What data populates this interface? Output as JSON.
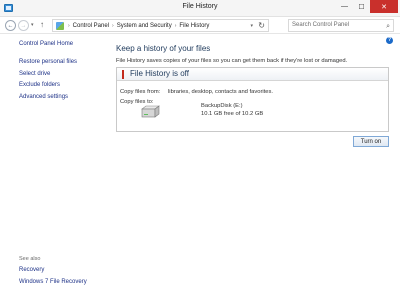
{
  "window": {
    "title": "File History",
    "minimize_glyph": "—",
    "maximize_glyph": "☐",
    "close_glyph": "✕"
  },
  "addressbar": {
    "back_glyph": "←",
    "forward_glyph": "→",
    "recent_glyph": "▾",
    "up_glyph": "↑",
    "breadcrumbs": [
      "Control Panel",
      "System and Security",
      "File History"
    ],
    "separator": "›",
    "dropdown_glyph": "▾",
    "refresh_glyph": "↻",
    "search_placeholder": "Search Control Panel",
    "search_glyph": "⌕"
  },
  "help": {
    "glyph": "?"
  },
  "sidebar": {
    "home": "Control Panel Home",
    "items": [
      "Restore personal files",
      "Select drive",
      "Exclude folders",
      "Advanced settings"
    ],
    "see_also_heading": "See also",
    "see_also": [
      "Recovery",
      "Windows 7 File Recovery"
    ]
  },
  "main": {
    "heading": "Keep a history of your files",
    "description": "File History saves copies of your files so you can get them back if they're lost or damaged.",
    "status": {
      "title": "File History is off",
      "copy_from_label": "Copy files from:",
      "copy_from_value": "libraries, desktop, contacts and favorites.",
      "copy_to_label": "Copy files to:",
      "drive_name": "BackupDisk (E:)",
      "drive_free": "10.1 GB free of 10.2 GB"
    },
    "turn_on_label": "Turn on"
  }
}
